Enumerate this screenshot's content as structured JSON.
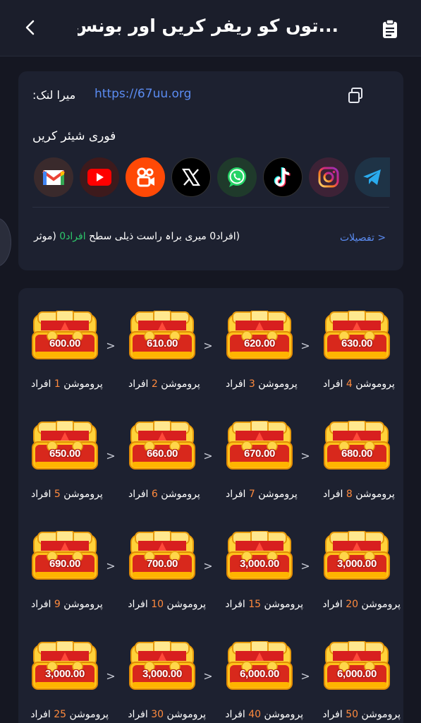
{
  "header": {
    "title": "...توں کو ریفر کریں اور بونس پائیں",
    "back_icon": "chevron-left-icon",
    "clipboard_icon": "clipboard-icon"
  },
  "link": {
    "label": "میرا لنک:",
    "url": "https://67uu.org",
    "copy_icon": "copy-icon"
  },
  "share": {
    "title": "فوری شیئر کریں",
    "platforms": [
      "Gmail",
      "YouTube",
      "Kuaishou",
      "X",
      "WhatsApp",
      "TikTok",
      "Instagram",
      "Telegram"
    ]
  },
  "stats": {
    "prefix": "(افراد0 میری براہ راست ذیلی سطح ",
    "highlight": "افراد0",
    "suffix": " (موثر",
    "details": "< تفصیلات"
  },
  "rewards": [
    {
      "amount": "600.00",
      "word": "پروموشن",
      "num": "1",
      "unit": "افراد"
    },
    {
      "amount": "610.00",
      "word": "پروموشن",
      "num": "2",
      "unit": "افراد"
    },
    {
      "amount": "620.00",
      "word": "پروموشن",
      "num": "3",
      "unit": "افراد"
    },
    {
      "amount": "630.00",
      "word": "پروموشن",
      "num": "4",
      "unit": "افراد"
    },
    {
      "amount": "650.00",
      "word": "پروموشن",
      "num": "5",
      "unit": "افراد"
    },
    {
      "amount": "660.00",
      "word": "پروموشن",
      "num": "6",
      "unit": "افراد"
    },
    {
      "amount": "670.00",
      "word": "پروموشن",
      "num": "7",
      "unit": "افراد"
    },
    {
      "amount": "680.00",
      "word": "پروموشن",
      "num": "8",
      "unit": "افراد"
    },
    {
      "amount": "690.00",
      "word": "پروموشن",
      "num": "9",
      "unit": "افراد"
    },
    {
      "amount": "700.00",
      "word": "پروموشن",
      "num": "10",
      "unit": "افراد"
    },
    {
      "amount": "3,000.00",
      "word": "پروموشن",
      "num": "15",
      "unit": "افراد"
    },
    {
      "amount": "3,000.00",
      "word": "پروموشن",
      "num": "20",
      "unit": "افراد"
    },
    {
      "amount": "3,000.00",
      "word": "پروموشن",
      "num": "25",
      "unit": "افراد"
    },
    {
      "amount": "3,000.00",
      "word": "پروموشن",
      "num": "30",
      "unit": "افراد"
    },
    {
      "amount": "6,000.00",
      "word": "پروموشن",
      "num": "40",
      "unit": "افراد"
    },
    {
      "amount": "6,000.00",
      "word": "پروموشن",
      "num": "50",
      "unit": "افراد"
    }
  ],
  "arrow_symbol": ">",
  "colors": {
    "background": "#151722",
    "card": "#1d2130",
    "link": "#5b8cf2",
    "accent_orange": "#ff8a3d",
    "accent_green": "#2ec76b"
  }
}
